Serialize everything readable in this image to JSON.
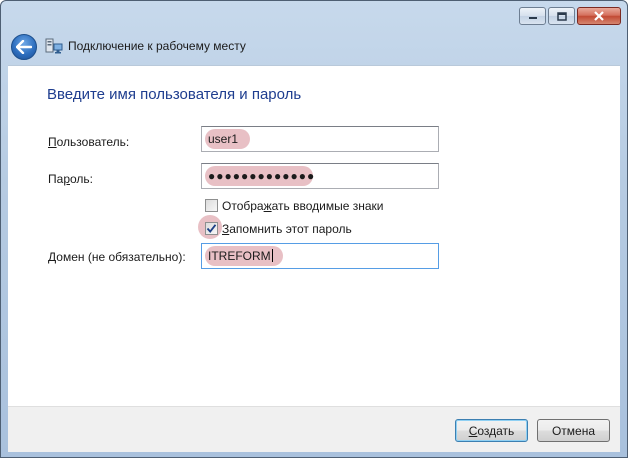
{
  "window": {
    "title": "Подключение к рабочему месту",
    "controls": [
      "minimize",
      "maximize",
      "close"
    ]
  },
  "heading": "Введите имя пользователя и пароль",
  "form": {
    "username_label_prefix": "П",
    "username_label_rest": "ользователь:",
    "username_value": "user1",
    "password_label_prefix": "Па",
    "password_label_mnemonic": "р",
    "password_label_rest": "оль:",
    "password_value": "●●●●●●●●●●●●●",
    "show_chars_label_prefix": "Отобра",
    "show_chars_label_mnemonic": "ж",
    "show_chars_label_rest": "ать вводимые знаки",
    "show_chars_checked": false,
    "remember_label_mnemonic": "З",
    "remember_label_rest": "апомнить этот пароль",
    "remember_checked": true,
    "domain_label_prefix": "Д",
    "domain_label_rest": "омен (не обязательно):",
    "domain_value": "ITREFORM"
  },
  "buttons": {
    "create_mnemonic": "С",
    "create_rest": "оздать",
    "cancel": "Отмена"
  },
  "icons": {
    "back": "back-arrow-icon",
    "app": "network-connection-icon",
    "check": "checkmark-icon"
  },
  "colors": {
    "heading": "#1e3d8f",
    "highlight": "#d68c96",
    "titlebar": "#b6cbe2",
    "close_button": "#c24a34"
  }
}
